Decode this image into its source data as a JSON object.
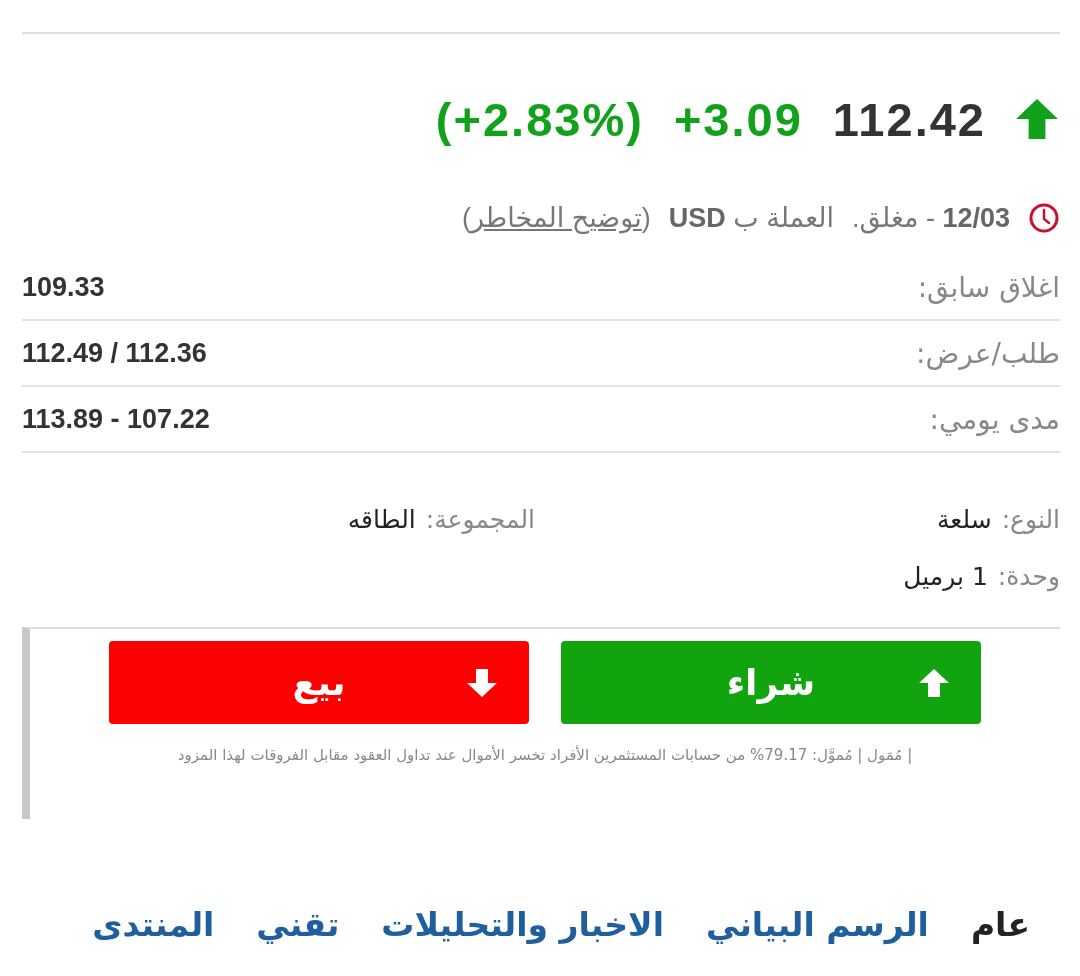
{
  "quote": {
    "rising": true,
    "price": "112.42",
    "change": "+3.09",
    "change_percent": "(+2.83%)"
  },
  "market_info": {
    "status": "**12/03** - مغلق.",
    "currency": "العملة ب **USD**",
    "risk_link": {
      "before": "(",
      "text": "توضيح المخاطر",
      "after": ")"
    }
  },
  "stats": [
    {
      "label": "اغلاق سابق:",
      "value": "109.33"
    },
    {
      "label": "طلب/عرض:",
      "value": "112.49 / 112.36"
    },
    {
      "label": "مدى يومي:",
      "value": "113.89 - 107.22"
    }
  ],
  "details": [
    {
      "label": "النوع:",
      "value": "سلعة"
    },
    {
      "label": "المجموعة:",
      "value": "الطاقه"
    },
    {
      "label": "وحدة:",
      "value": "1 برميل"
    }
  ],
  "trade_buttons": [
    {
      "kind": "buy",
      "label": "شراء"
    },
    {
      "kind": "sell",
      "label": "بيع"
    }
  ],
  "disclaimer": "| مُمَول | مُموَّل: 79.17% من حسابات المستثمرين الأفراد تخسر الأموال عند تداول العقود مقابل الفروقات لهذا المزود",
  "nav": {
    "items": [
      {
        "label": "عام",
        "selected": true
      },
      {
        "label": "الرسم البياني",
        "selected": false
      },
      {
        "label": "الاخبار والتحليلات",
        "selected": false
      },
      {
        "label": "تقني",
        "selected": false
      },
      {
        "label": "المنتدى",
        "selected": false
      }
    ]
  }
}
